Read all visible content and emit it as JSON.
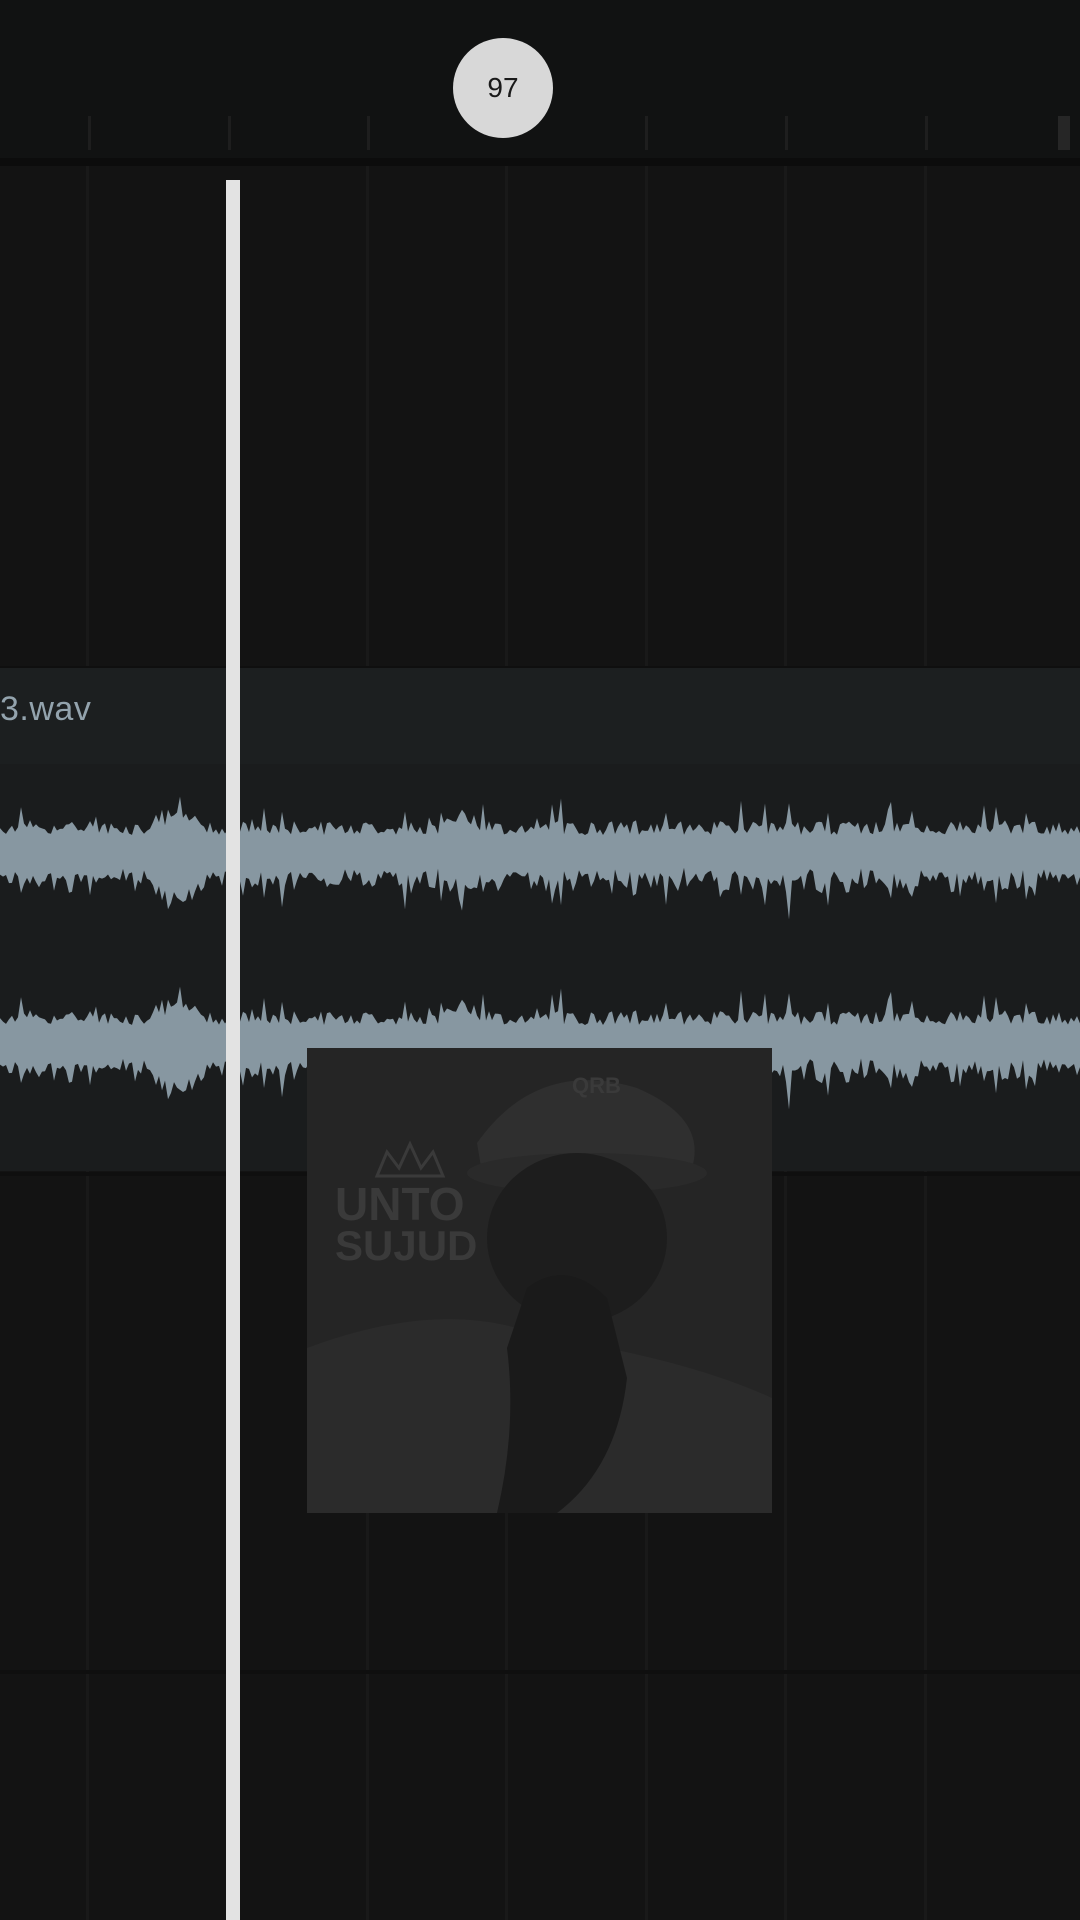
{
  "timeline": {
    "bar_marker_label": "97"
  },
  "audio_clip": {
    "file_name": "3.wav",
    "waveform_color": "#8797a1"
  },
  "image_clip": {
    "logo_text_line1": "UNTO",
    "logo_text_line2": "SUJUD",
    "cap_text": "QRB"
  },
  "colors": {
    "background": "#131313",
    "ruler_background": "#111212",
    "audio_clip_background": "#1a1c1d",
    "playhead": "#e3e3e3",
    "bar_marker": "#d8d8d8"
  }
}
